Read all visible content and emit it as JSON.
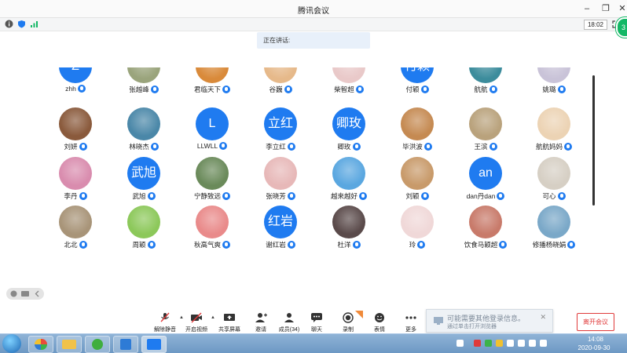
{
  "window": {
    "title": "腾讯会议",
    "time": "18:02",
    "badge": "3"
  },
  "speaking": {
    "label": "正在讲话:"
  },
  "participants": [
    {
      "name": "zhh",
      "avatar_text": "Z",
      "avatar_type": "initials"
    },
    {
      "name": "张越峰",
      "avatar_type": "photo",
      "color": "#9aa47c"
    },
    {
      "name": "君临天下",
      "avatar_type": "photo",
      "color": "#d98a3a"
    },
    {
      "name": "谷巍",
      "avatar_type": "photo",
      "color": "#e6b98a"
    },
    {
      "name": "柴智超",
      "avatar_type": "photo",
      "color": "#e9c9c9"
    },
    {
      "name": "付颖",
      "avatar_text": "付颖",
      "avatar_type": "initials"
    },
    {
      "name": "航航",
      "avatar_type": "photo",
      "color": "#3c8c9c"
    },
    {
      "name": "姚璐",
      "avatar_type": "photo",
      "color": "#c9c3d8"
    },
    {
      "name": "刘妍",
      "avatar_type": "photo",
      "color": "#8a5a3c"
    },
    {
      "name": "林晓杰",
      "avatar_type": "photo",
      "color": "#4a87a8"
    },
    {
      "name": "LLWLL",
      "avatar_text": "L",
      "avatar_type": "initials"
    },
    {
      "name": "李立红",
      "avatar_text": "立红",
      "avatar_type": "initials"
    },
    {
      "name": "卿玫",
      "avatar_text": "卿玫",
      "avatar_type": "initials"
    },
    {
      "name": "毕洪波",
      "avatar_type": "photo",
      "color": "#c58a52"
    },
    {
      "name": "王滨",
      "avatar_type": "photo",
      "color": "#b9a27c"
    },
    {
      "name": "航航妈妈",
      "avatar_type": "photo",
      "color": "#ecd3b4"
    },
    {
      "name": "李丹",
      "avatar_type": "photo",
      "color": "#d98cae"
    },
    {
      "name": "武旭",
      "avatar_text": "武旭",
      "avatar_type": "initials"
    },
    {
      "name": "宁静致远",
      "avatar_type": "photo",
      "color": "#6a8a5a"
    },
    {
      "name": "张晓芳",
      "avatar_type": "photo",
      "color": "#e7b8b8"
    },
    {
      "name": "越来越好",
      "avatar_type": "photo",
      "color": "#5aa7e0"
    },
    {
      "name": "刘颖",
      "avatar_type": "photo",
      "color": "#c89a6a"
    },
    {
      "name": "dan丹dan",
      "avatar_text": "an",
      "avatar_type": "initials"
    },
    {
      "name": "可心",
      "avatar_type": "photo",
      "color": "#d6cfc4"
    },
    {
      "name": "北北",
      "avatar_type": "photo",
      "color": "#a89478"
    },
    {
      "name": "周颖",
      "avatar_type": "photo",
      "color": "#8cc85a"
    },
    {
      "name": "秋高气爽",
      "avatar_type": "photo",
      "color": "#e98a8a"
    },
    {
      "name": "谢红岩",
      "avatar_text": "红岩",
      "avatar_type": "initials"
    },
    {
      "name": "杜洋",
      "avatar_type": "photo",
      "color": "#5a4a4a"
    },
    {
      "name": "玲",
      "avatar_type": "photo",
      "color": "#f0d8d8"
    },
    {
      "name": "饮食马颖超",
      "avatar_type": "photo",
      "color": "#c87a6a"
    },
    {
      "name": "修播杨晓娟",
      "avatar_type": "photo",
      "color": "#7aa8c8"
    }
  ],
  "toolbar": {
    "mute": "解除静音",
    "video": "开启视频",
    "share": "共享屏幕",
    "invite": "邀请",
    "members": "成员(34)",
    "chat": "聊天",
    "record": "录制",
    "reaction": "表情",
    "more": "更多",
    "leave": "离开会议"
  },
  "popup": {
    "line1": "可能需要其他登录信息。",
    "line2": "通过单击打开浏览器"
  },
  "taskbar": {
    "time": "14:08",
    "date": "2020-09-30"
  },
  "colors": {
    "accent": "#1f7bf0",
    "leave": "#e03a3a",
    "green": "#13b866"
  }
}
